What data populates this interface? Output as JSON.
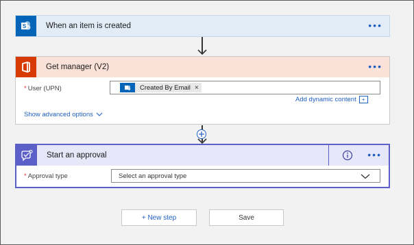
{
  "trigger": {
    "title": "When an item is created",
    "more_icon": "ellipsis-icon",
    "tile_icon": "sharepoint-icon",
    "color": "#0364b8"
  },
  "get_manager": {
    "title": "Get manager (V2)",
    "tile_icon": "office-icon",
    "color": "#d83b01",
    "user_label": "User (UPN)",
    "token_label": "Created By Email",
    "token_remove": "×",
    "add_dynamic": "Add dynamic content",
    "show_advanced": "Show advanced options"
  },
  "approval": {
    "title": "Start an approval",
    "tile_icon": "approval-icon",
    "color": "#5b5fc7",
    "type_label": "Approval type",
    "type_placeholder": "Select an approval type"
  },
  "footer": {
    "new_step": "+ New step",
    "save": "Save"
  }
}
